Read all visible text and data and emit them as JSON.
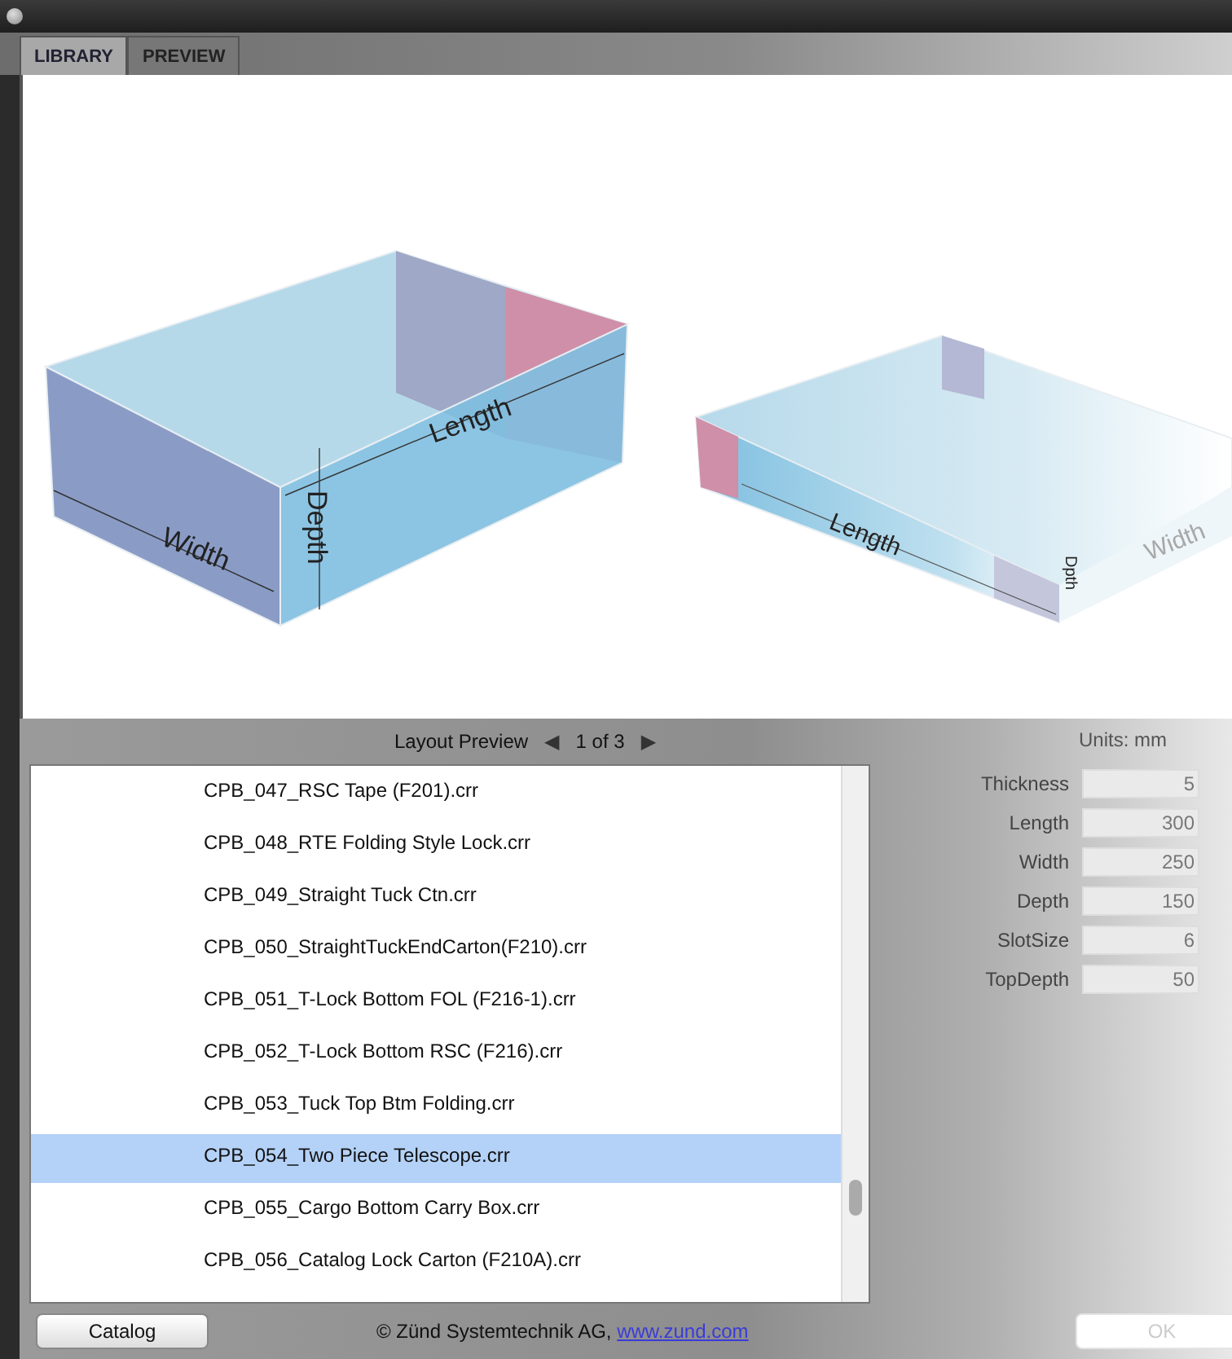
{
  "tabs": [
    {
      "label": "LIBRARY",
      "selected": true
    },
    {
      "label": "PREVIEW",
      "selected": false
    }
  ],
  "preview": {
    "drawings": [
      {
        "kind": "closed",
        "labels": [
          "Width",
          "Depth",
          "Length"
        ]
      },
      {
        "kind": "flat",
        "labels": [
          "Length",
          "Dpth",
          "Width"
        ]
      }
    ]
  },
  "pager": {
    "title": "Layout Preview",
    "prev": "◀",
    "page": "1 of 3",
    "next": "▶"
  },
  "files": [
    {
      "name": "CPB_047_RSC Tape (F201).crr",
      "selected": false
    },
    {
      "name": "CPB_048_RTE Folding Style Lock.crr",
      "selected": false
    },
    {
      "name": "CPB_049_Straight Tuck Ctn.crr",
      "selected": false
    },
    {
      "name": "CPB_050_StraightTuckEndCarton(F210).crr",
      "selected": false
    },
    {
      "name": "CPB_051_T-Lock Bottom FOL (F216-1).crr",
      "selected": false
    },
    {
      "name": "CPB_052_T-Lock Bottom RSC (F216).crr",
      "selected": false
    },
    {
      "name": "CPB_053_Tuck Top Btm Folding.crr",
      "selected": false
    },
    {
      "name": "CPB_054_Two Piece Telescope.crr",
      "selected": true
    },
    {
      "name": "CPB_055_Cargo Bottom Carry Box.crr",
      "selected": false
    },
    {
      "name": "CPB_056_Catalog Lock Carton (F210A).crr",
      "selected": false
    }
  ],
  "units": "Units: mm",
  "params": [
    {
      "label": "Thickness",
      "value": "5",
      "disabled": true
    },
    {
      "label": "Length",
      "value": "300",
      "disabled": true
    },
    {
      "label": "Width",
      "value": "250",
      "disabled": true
    },
    {
      "label": "Depth",
      "value": "150",
      "disabled": true
    },
    {
      "label": "SlotSize",
      "value": "6",
      "disabled": true
    },
    {
      "label": "TopDepth",
      "value": "50",
      "disabled": true
    }
  ],
  "footer": {
    "catalog_button": "Catalog",
    "copyright": "© Zünd Systemtechnik AG,",
    "link": "www.zund.com",
    "ok_button": {
      "label": "OK",
      "disabled": true
    }
  }
}
